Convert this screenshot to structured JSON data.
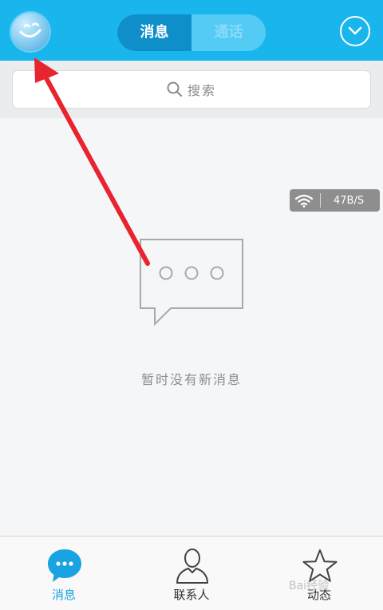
{
  "header": {
    "tabs": [
      {
        "label": "消息",
        "active": true
      },
      {
        "label": "通话",
        "active": false
      }
    ],
    "avatar_icon": "avatar-icon",
    "dropdown_icon": "chevron-down-icon"
  },
  "search": {
    "label": "搜索"
  },
  "network": {
    "speed": "47B/S"
  },
  "empty_state": {
    "text": "暂时没有新消息"
  },
  "bottom_nav": [
    {
      "label": "消息",
      "icon": "message-icon",
      "active": true
    },
    {
      "label": "联系人",
      "icon": "contacts-icon",
      "active": false
    },
    {
      "label": "动态",
      "icon": "star-icon",
      "active": false
    }
  ],
  "watermark": "Bai经验",
  "colors": {
    "header": "#19b6ee",
    "active_tab": "#0e8fca",
    "accent": "#1aa3e2",
    "annotation_arrow": "#e8242e"
  }
}
